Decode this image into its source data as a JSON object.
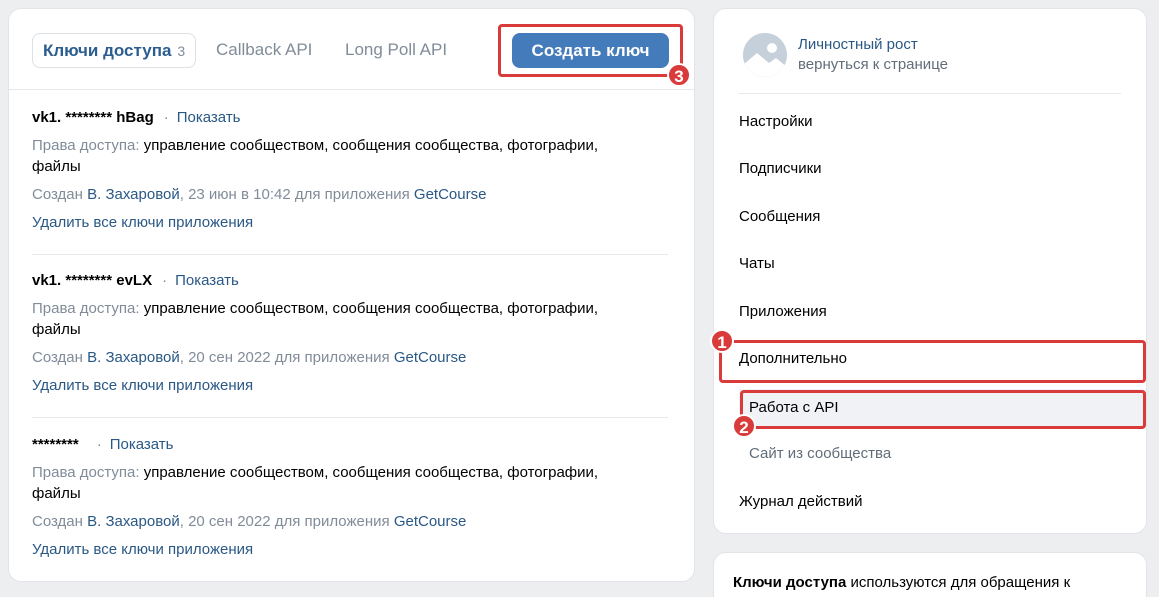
{
  "tabs": {
    "keys_label": "Ключи доступа",
    "keys_count": "3",
    "callback_label": "Callback API",
    "longpoll_label": "Long Poll API"
  },
  "create_button": "Создать ключ",
  "keys": [
    {
      "name": "vk1. ******** hBag",
      "show": "Показать",
      "rights_label": "Права доступа:",
      "rights_line1": "управление сообществом, сообщения сообщества, фотографии,",
      "rights_line2": "файлы",
      "created_prefix": "Создан",
      "created_by": "В. Захаровой",
      "created_when": ", 23 июн в 10:42 для приложения",
      "app": "GetCourse",
      "delete": "Удалить все ключи приложения"
    },
    {
      "name": "vk1. ******** evLX",
      "show": "Показать",
      "rights_label": "Права доступа:",
      "rights_line1": "управление сообществом, сообщения сообщества, фотографии,",
      "rights_line2": "файлы",
      "created_prefix": "Создан",
      "created_by": "В. Захаровой",
      "created_when": ", 20 сен 2022 для приложения",
      "app": "GetCourse",
      "delete": "Удалить все ключи приложения"
    },
    {
      "name": "********",
      "show": "Показать",
      "rights_label": "Права доступа:",
      "rights_line1": "управление сообществом, сообщения сообщества, фотографии,",
      "rights_line2": "файлы",
      "created_prefix": "Создан",
      "created_by": "В. Захаровой",
      "created_when": ", 20 сен 2022 для приложения",
      "app": "GetCourse",
      "delete": "Удалить все ключи приложения"
    }
  ],
  "community": {
    "name": "Личностный рост",
    "back": "вернуться к странице"
  },
  "menu": {
    "settings": "Настройки",
    "subscribers": "Подписчики",
    "messages": "Сообщения",
    "chats": "Чаты",
    "apps": "Приложения",
    "advanced": "Дополнительно",
    "api": "Работа с API",
    "site": "Сайт из сообщества",
    "log": "Журнал действий"
  },
  "info": {
    "bold": "Ключи доступа",
    "rest": " используются для обращения к"
  },
  "annotations": [
    "1",
    "2",
    "3"
  ],
  "colors": {
    "accent": "#447bba",
    "link": "#2a5885",
    "annotation": "#d93a3a",
    "background": "#edeef0"
  }
}
